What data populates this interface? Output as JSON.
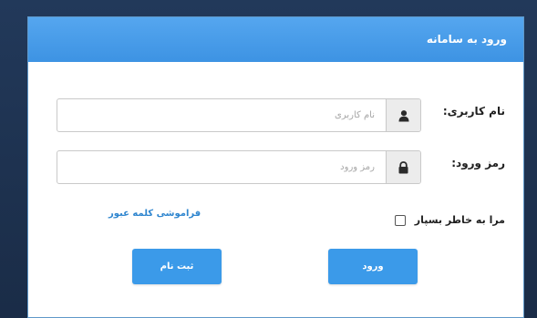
{
  "header": {
    "title": "ورود به سامانه"
  },
  "form": {
    "username": {
      "label": "نام کاربری:",
      "placeholder": "نام کاربری",
      "value": "",
      "icon": "user-icon"
    },
    "password": {
      "label": "رمز ورود:",
      "placeholder": "رمز ورود",
      "value": "",
      "icon": "lock-icon"
    },
    "remember": {
      "label": "مرا به خاطر بسپار",
      "checked": false
    },
    "forgot_link": "فراموشی کلمه عبور"
  },
  "buttons": {
    "login": "ورود",
    "register": "ثبت نام"
  },
  "colors": {
    "header": "#3d93e3",
    "button": "#3b9ae9",
    "link": "#2f86cf"
  }
}
